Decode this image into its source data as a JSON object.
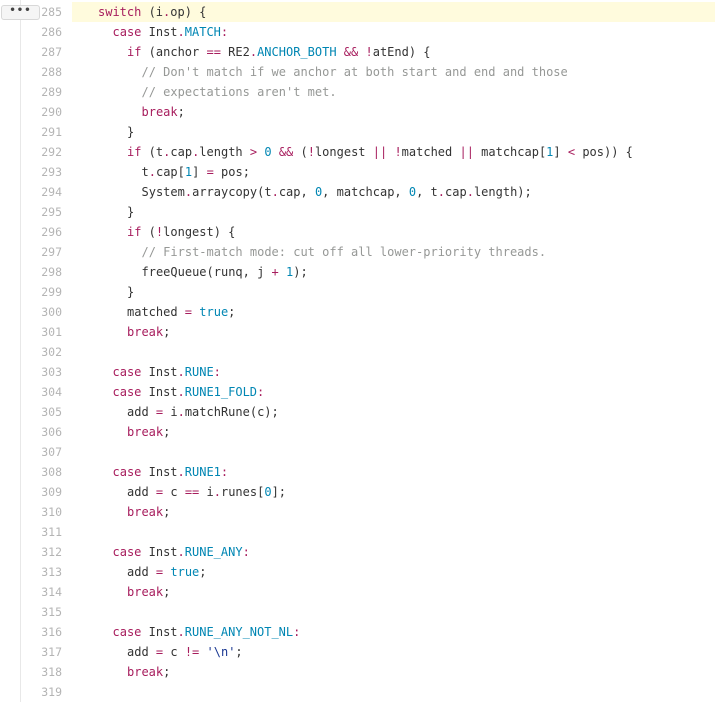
{
  "expand_button": {
    "label": "•••"
  },
  "lines": [
    {
      "n": "285",
      "highlight": true,
      "indent": 2,
      "tokens": [
        [
          "kw",
          "switch"
        ],
        [
          "def",
          " (i"
        ],
        [
          "op",
          "."
        ],
        [
          "def",
          "op) {"
        ]
      ]
    },
    {
      "n": "286",
      "indent": 3,
      "tokens": [
        [
          "kw",
          "case"
        ],
        [
          "def",
          " Inst"
        ],
        [
          "op",
          "."
        ],
        [
          "cst",
          "MATCH"
        ],
        [
          "op",
          ":"
        ]
      ]
    },
    {
      "n": "287",
      "indent": 4,
      "tokens": [
        [
          "kw",
          "if"
        ],
        [
          "def",
          " (anchor "
        ],
        [
          "op",
          "=="
        ],
        [
          "def",
          " RE2"
        ],
        [
          "op",
          "."
        ],
        [
          "cst",
          "ANCHOR_BOTH"
        ],
        [
          "def",
          " "
        ],
        [
          "op",
          "&&"
        ],
        [
          "def",
          " "
        ],
        [
          "op",
          "!"
        ],
        [
          "def",
          "atEnd) {"
        ]
      ]
    },
    {
      "n": "288",
      "indent": 5,
      "tokens": [
        [
          "cm",
          "// Don't match if we anchor at both start and end and those"
        ]
      ]
    },
    {
      "n": "289",
      "indent": 5,
      "tokens": [
        [
          "cm",
          "// expectations aren't met."
        ]
      ]
    },
    {
      "n": "290",
      "indent": 5,
      "tokens": [
        [
          "kw",
          "break"
        ],
        [
          "def",
          ";"
        ]
      ]
    },
    {
      "n": "291",
      "indent": 4,
      "tokens": [
        [
          "def",
          "}"
        ]
      ]
    },
    {
      "n": "292",
      "indent": 4,
      "tokens": [
        [
          "kw",
          "if"
        ],
        [
          "def",
          " (t"
        ],
        [
          "op",
          "."
        ],
        [
          "def",
          "cap"
        ],
        [
          "op",
          "."
        ],
        [
          "def",
          "length "
        ],
        [
          "op",
          ">"
        ],
        [
          "def",
          " "
        ],
        [
          "nm",
          "0"
        ],
        [
          "def",
          " "
        ],
        [
          "op",
          "&&"
        ],
        [
          "def",
          " ("
        ],
        [
          "op",
          "!"
        ],
        [
          "def",
          "longest "
        ],
        [
          "op",
          "||"
        ],
        [
          "def",
          " "
        ],
        [
          "op",
          "!"
        ],
        [
          "def",
          "matched "
        ],
        [
          "op",
          "||"
        ],
        [
          "def",
          " matchcap["
        ],
        [
          "nm",
          "1"
        ],
        [
          "def",
          "] "
        ],
        [
          "op",
          "<"
        ],
        [
          "def",
          " pos)) {"
        ]
      ]
    },
    {
      "n": "293",
      "indent": 5,
      "tokens": [
        [
          "def",
          "t"
        ],
        [
          "op",
          "."
        ],
        [
          "def",
          "cap["
        ],
        [
          "nm",
          "1"
        ],
        [
          "def",
          "] "
        ],
        [
          "op",
          "="
        ],
        [
          "def",
          " pos;"
        ]
      ]
    },
    {
      "n": "294",
      "indent": 5,
      "tokens": [
        [
          "def",
          "System"
        ],
        [
          "op",
          "."
        ],
        [
          "def",
          "arraycopy(t"
        ],
        [
          "op",
          "."
        ],
        [
          "def",
          "cap, "
        ],
        [
          "nm",
          "0"
        ],
        [
          "def",
          ", matchcap, "
        ],
        [
          "nm",
          "0"
        ],
        [
          "def",
          ", t"
        ],
        [
          "op",
          "."
        ],
        [
          "def",
          "cap"
        ],
        [
          "op",
          "."
        ],
        [
          "def",
          "length);"
        ]
      ]
    },
    {
      "n": "295",
      "indent": 4,
      "tokens": [
        [
          "def",
          "}"
        ]
      ]
    },
    {
      "n": "296",
      "indent": 4,
      "tokens": [
        [
          "kw",
          "if"
        ],
        [
          "def",
          " ("
        ],
        [
          "op",
          "!"
        ],
        [
          "def",
          "longest) {"
        ]
      ]
    },
    {
      "n": "297",
      "indent": 5,
      "tokens": [
        [
          "cm",
          "// First-match mode: cut off all lower-priority threads."
        ]
      ]
    },
    {
      "n": "298",
      "indent": 5,
      "tokens": [
        [
          "def",
          "freeQueue(runq, j "
        ],
        [
          "op",
          "+"
        ],
        [
          "def",
          " "
        ],
        [
          "nm",
          "1"
        ],
        [
          "def",
          ");"
        ]
      ]
    },
    {
      "n": "299",
      "indent": 4,
      "tokens": [
        [
          "def",
          "}"
        ]
      ]
    },
    {
      "n": "300",
      "indent": 4,
      "tokens": [
        [
          "def",
          "matched "
        ],
        [
          "op",
          "="
        ],
        [
          "def",
          " "
        ],
        [
          "cst",
          "true"
        ],
        [
          "def",
          ";"
        ]
      ]
    },
    {
      "n": "301",
      "indent": 4,
      "tokens": [
        [
          "kw",
          "break"
        ],
        [
          "def",
          ";"
        ]
      ]
    },
    {
      "n": "302",
      "indent": 0,
      "tokens": []
    },
    {
      "n": "303",
      "indent": 3,
      "tokens": [
        [
          "kw",
          "case"
        ],
        [
          "def",
          " Inst"
        ],
        [
          "op",
          "."
        ],
        [
          "cst",
          "RUNE"
        ],
        [
          "op",
          ":"
        ]
      ]
    },
    {
      "n": "304",
      "indent": 3,
      "tokens": [
        [
          "kw",
          "case"
        ],
        [
          "def",
          " Inst"
        ],
        [
          "op",
          "."
        ],
        [
          "cst",
          "RUNE1_FOLD"
        ],
        [
          "op",
          ":"
        ]
      ]
    },
    {
      "n": "305",
      "indent": 4,
      "tokens": [
        [
          "def",
          "add "
        ],
        [
          "op",
          "="
        ],
        [
          "def",
          " i"
        ],
        [
          "op",
          "."
        ],
        [
          "def",
          "matchRune(c);"
        ]
      ]
    },
    {
      "n": "306",
      "indent": 4,
      "tokens": [
        [
          "kw",
          "break"
        ],
        [
          "def",
          ";"
        ]
      ]
    },
    {
      "n": "307",
      "indent": 0,
      "tokens": []
    },
    {
      "n": "308",
      "indent": 3,
      "tokens": [
        [
          "kw",
          "case"
        ],
        [
          "def",
          " Inst"
        ],
        [
          "op",
          "."
        ],
        [
          "cst",
          "RUNE1"
        ],
        [
          "op",
          ":"
        ]
      ]
    },
    {
      "n": "309",
      "indent": 4,
      "tokens": [
        [
          "def",
          "add "
        ],
        [
          "op",
          "="
        ],
        [
          "def",
          " c "
        ],
        [
          "op",
          "=="
        ],
        [
          "def",
          " i"
        ],
        [
          "op",
          "."
        ],
        [
          "def",
          "runes["
        ],
        [
          "nm",
          "0"
        ],
        [
          "def",
          "];"
        ]
      ]
    },
    {
      "n": "310",
      "indent": 4,
      "tokens": [
        [
          "kw",
          "break"
        ],
        [
          "def",
          ";"
        ]
      ]
    },
    {
      "n": "311",
      "indent": 0,
      "tokens": []
    },
    {
      "n": "312",
      "indent": 3,
      "tokens": [
        [
          "kw",
          "case"
        ],
        [
          "def",
          " Inst"
        ],
        [
          "op",
          "."
        ],
        [
          "cst",
          "RUNE_ANY"
        ],
        [
          "op",
          ":"
        ]
      ]
    },
    {
      "n": "313",
      "indent": 4,
      "tokens": [
        [
          "def",
          "add "
        ],
        [
          "op",
          "="
        ],
        [
          "def",
          " "
        ],
        [
          "cst",
          "true"
        ],
        [
          "def",
          ";"
        ]
      ]
    },
    {
      "n": "314",
      "indent": 4,
      "tokens": [
        [
          "kw",
          "break"
        ],
        [
          "def",
          ";"
        ]
      ]
    },
    {
      "n": "315",
      "indent": 0,
      "tokens": []
    },
    {
      "n": "316",
      "indent": 3,
      "tokens": [
        [
          "kw",
          "case"
        ],
        [
          "def",
          " Inst"
        ],
        [
          "op",
          "."
        ],
        [
          "cst",
          "RUNE_ANY_NOT_NL"
        ],
        [
          "op",
          ":"
        ]
      ]
    },
    {
      "n": "317",
      "indent": 4,
      "tokens": [
        [
          "def",
          "add "
        ],
        [
          "op",
          "="
        ],
        [
          "def",
          " c "
        ],
        [
          "op",
          "!="
        ],
        [
          "def",
          " "
        ],
        [
          "str",
          "'\\n'"
        ],
        [
          "def",
          ";"
        ]
      ]
    },
    {
      "n": "318",
      "indent": 4,
      "tokens": [
        [
          "kw",
          "break"
        ],
        [
          "def",
          ";"
        ]
      ]
    },
    {
      "n": "319",
      "indent": 0,
      "tokens": []
    }
  ]
}
